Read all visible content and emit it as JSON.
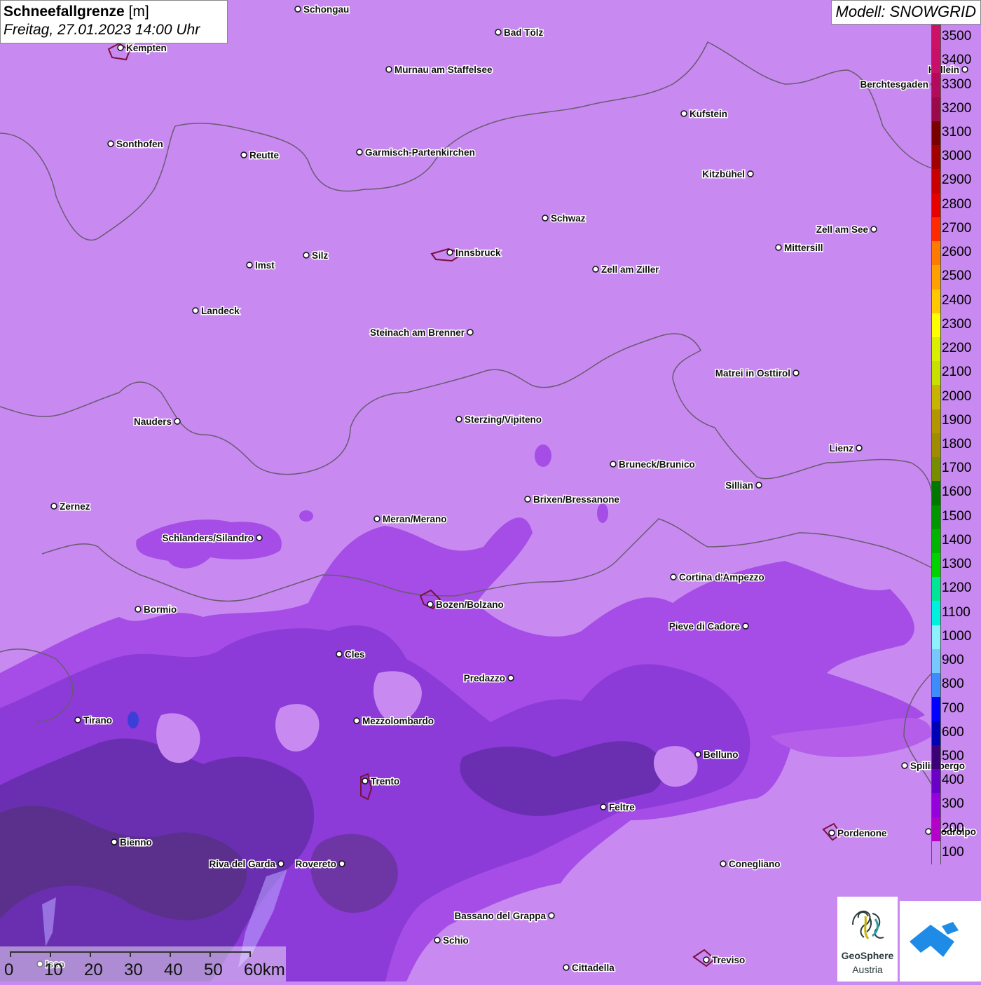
{
  "title": {
    "main": "Schneefallgrenze",
    "unit": "[m]",
    "date": "Freitag, 27.01.2023 14:00 Uhr"
  },
  "model": "Modell: SNOWGRID",
  "colors": {
    "base": "#c88af0",
    "border": "#6a5a72",
    "band_300": "#a54de6",
    "band_400": "#8c3ad8",
    "band_500": "#6a2fb0",
    "dark": "#4e3170",
    "blue": "#3b3fd8"
  },
  "legend": {
    "labels": [
      "3500",
      "3400",
      "3300",
      "3200",
      "3100",
      "3000",
      "2900",
      "2800",
      "2700",
      "2600",
      "2500",
      "2400",
      "2300",
      "2200",
      "2100",
      "2000",
      "1900",
      "1800",
      "1700",
      "1600",
      "1500",
      "1400",
      "1300",
      "1200",
      "1100",
      "1000",
      "900",
      "800",
      "700",
      "600",
      "500",
      "400",
      "300",
      "200",
      "100"
    ],
    "colors": [
      "#cc1166",
      "#c8106a",
      "#b40a5c",
      "#9a0a4a",
      "#7a0000",
      "#a00000",
      "#c80000",
      "#e60000",
      "#ff2a00",
      "#ff7a00",
      "#ffa000",
      "#ffc800",
      "#ffff00",
      "#d8f000",
      "#c8e000",
      "#c8b400",
      "#b49600",
      "#a08c00",
      "#788c00",
      "#007800",
      "#009600",
      "#00b400",
      "#00d200",
      "#00e696",
      "#00f0e0",
      "#8cf0ff",
      "#78c8ff",
      "#3c8cff",
      "#0000ff",
      "#0000b4",
      "#3c0078",
      "#6a00c8",
      "#9600dc",
      "#b400c8",
      "#c88af0"
    ]
  },
  "cities": [
    {
      "name": "Schongau",
      "label_side": "right"
    },
    {
      "name": "Bad Tölz",
      "label_side": "right"
    },
    {
      "name": "Kempten",
      "label_side": "right"
    },
    {
      "name": "Murnau am Staffelsee",
      "label_side": "right"
    },
    {
      "name": "Berchtesgaden",
      "label_side": "left"
    },
    {
      "name": "Kufstein",
      "label_side": "right"
    },
    {
      "name": "Sonthofen",
      "label_side": "right"
    },
    {
      "name": "Reutte",
      "label_side": "right"
    },
    {
      "name": "Garmisch-Partenkirchen",
      "label_side": "right"
    },
    {
      "name": "Kitzbühel",
      "label_side": "left"
    },
    {
      "name": "Schwaz",
      "label_side": "right"
    },
    {
      "name": "Zell am See",
      "label_side": "left"
    },
    {
      "name": "Imst",
      "label_side": "right"
    },
    {
      "name": "Silz",
      "label_side": "right"
    },
    {
      "name": "Innsbruck",
      "label_side": "right"
    },
    {
      "name": "Mittersill",
      "label_side": "right"
    },
    {
      "name": "Zell am Ziller",
      "label_side": "right"
    },
    {
      "name": "Landeck",
      "label_side": "right"
    },
    {
      "name": "Steinach am Brenner",
      "label_side": "left"
    },
    {
      "name": "Matrei in Osttirol",
      "label_side": "left"
    },
    {
      "name": "Nauders",
      "label_side": "left"
    },
    {
      "name": "Sterzing/Vipiteno",
      "label_side": "right"
    },
    {
      "name": "Lienz",
      "label_side": "left"
    },
    {
      "name": "Bruneck/Brunico",
      "label_side": "right"
    },
    {
      "name": "Sillian",
      "label_side": "left"
    },
    {
      "name": "Zernez",
      "label_side": "right"
    },
    {
      "name": "Brixen/Bressanone",
      "label_side": "right"
    },
    {
      "name": "Meran/Merano",
      "label_side": "right"
    },
    {
      "name": "Schlanders/Silandro",
      "label_side": "left"
    },
    {
      "name": "Cortina d'Ampezzo",
      "label_side": "right"
    },
    {
      "name": "Bormio",
      "label_side": "right"
    },
    {
      "name": "Bozen/Bolzano",
      "label_side": "right"
    },
    {
      "name": "Pieve di Cadore",
      "label_side": "left"
    },
    {
      "name": "Cles",
      "label_side": "right"
    },
    {
      "name": "Predazzo",
      "label_side": "left"
    },
    {
      "name": "Tirano",
      "label_side": "right"
    },
    {
      "name": "Mezzolombardo",
      "label_side": "right"
    },
    {
      "name": "Belluno",
      "label_side": "right"
    },
    {
      "name": "Spilimbergo",
      "label_side": "right"
    },
    {
      "name": "Trento",
      "label_side": "right"
    },
    {
      "name": "Feltre",
      "label_side": "right"
    },
    {
      "name": "Pordenone",
      "label_side": "right"
    },
    {
      "name": "Bienno",
      "label_side": "right"
    },
    {
      "name": "Riva del Garda",
      "label_side": "left"
    },
    {
      "name": "Rovereto",
      "label_side": "left"
    },
    {
      "name": "Conegliano",
      "label_side": "right"
    },
    {
      "name": "Bassano del Grappa",
      "label_side": "left"
    },
    {
      "name": "Schio",
      "label_side": "right"
    },
    {
      "name": "Treviso",
      "label_side": "right"
    },
    {
      "name": "Cittadella",
      "label_side": "right"
    },
    {
      "name": "Hallein",
      "label_side": "left"
    },
    {
      "name": "Codroipo",
      "label_side": "right"
    },
    {
      "name": "Iseo",
      "label_side": "right"
    }
  ],
  "scale": {
    "labels": [
      "0",
      "10",
      "20",
      "30",
      "40",
      "50",
      "60km"
    ]
  },
  "logos": {
    "geosphere_line1": "GeoSphere",
    "geosphere_line2": "Austria"
  }
}
